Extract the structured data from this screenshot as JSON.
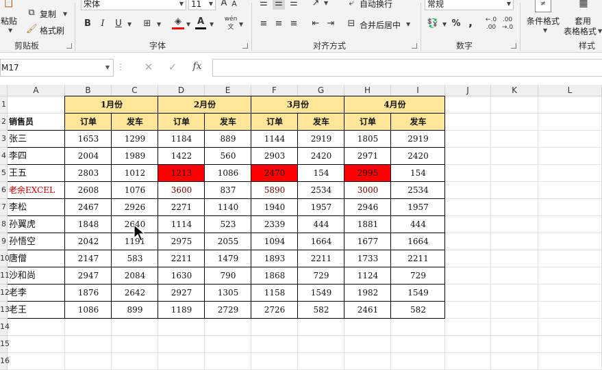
{
  "ribbon": {
    "clipboard": {
      "paste": "粘贴",
      "cut": "剪切",
      "copy": "复制",
      "painter": "格式刷",
      "label": "剪贴板"
    },
    "font": {
      "name": "宋体",
      "size": "11",
      "bold": "B",
      "italic": "I",
      "underline": "U",
      "pinyin": "wén",
      "label": "字体"
    },
    "align": {
      "wrap": "自动换行",
      "merge": "合并后居中",
      "label": "对齐方式"
    },
    "number": {
      "format": "常规",
      "percent": "%",
      "comma": ",",
      "inc_decimal": ".00",
      "dec_decimal": ".0",
      "label": "数字"
    },
    "styles": {
      "conditional": "条件格式",
      "table_fmt_1": "套用",
      "table_fmt_2": "表格格式",
      "label": "样式"
    }
  },
  "formula_bar": {
    "name_box": "M17",
    "cancel": "✕",
    "enter": "✓",
    "fx": "fx",
    "value": ""
  },
  "columns": [
    "A",
    "B",
    "C",
    "D",
    "E",
    "F",
    "G",
    "H",
    "I",
    "J",
    "K",
    "L"
  ],
  "rows": [
    "1",
    "2",
    "3",
    "4",
    "5",
    "6",
    "7",
    "8",
    "9",
    "10",
    "11",
    "12",
    "13",
    "14",
    "15",
    "16",
    "17"
  ],
  "sheet": {
    "months": [
      "1月份",
      "2月份",
      "3月份",
      "4月份"
    ],
    "corner_label": "销售员",
    "sub_headers": [
      "订单",
      "发车",
      "订单",
      "发车",
      "订单",
      "发车",
      "订单",
      "发车"
    ],
    "data": [
      [
        "张三",
        "1653",
        "1299",
        "1184",
        "889",
        "1144",
        "2919",
        "1805",
        "2919"
      ],
      [
        "李四",
        "2004",
        "1989",
        "1422",
        "560",
        "2903",
        "2420",
        "2971",
        "2420"
      ],
      [
        "王五",
        "2803",
        "1012",
        "1213",
        "1086",
        "2470",
        "154",
        "2995",
        "154"
      ],
      [
        "老余EXCEL",
        "2608",
        "1076",
        "3600",
        "837",
        "5890",
        "2534",
        "3000",
        "2534"
      ],
      [
        "李松",
        "2467",
        "2926",
        "2271",
        "1140",
        "1940",
        "1957",
        "2946",
        "1957"
      ],
      [
        "孙翼虎",
        "1848",
        "2640",
        "1114",
        "523",
        "2339",
        "444",
        "1881",
        "444"
      ],
      [
        "孙悟空",
        "2042",
        "1191",
        "2975",
        "2055",
        "1094",
        "1664",
        "1677",
        "1664"
      ],
      [
        "唐僧",
        "2147",
        "583",
        "2211",
        "1479",
        "1893",
        "2211",
        "1733",
        "2211"
      ],
      [
        "沙和尚",
        "2947",
        "2084",
        "1630",
        "790",
        "1868",
        "729",
        "1124",
        "729"
      ],
      [
        "老李",
        "1876",
        "2642",
        "2927",
        "1305",
        "1158",
        "1549",
        "1982",
        "1549"
      ],
      [
        "老王",
        "1086",
        "899",
        "1189",
        "2729",
        "2726",
        "582",
        "2461",
        "582"
      ]
    ],
    "highlight_name_color": "#cc0000",
    "highlight_fill": "#ff0000",
    "header_fill": "#ffe699"
  }
}
